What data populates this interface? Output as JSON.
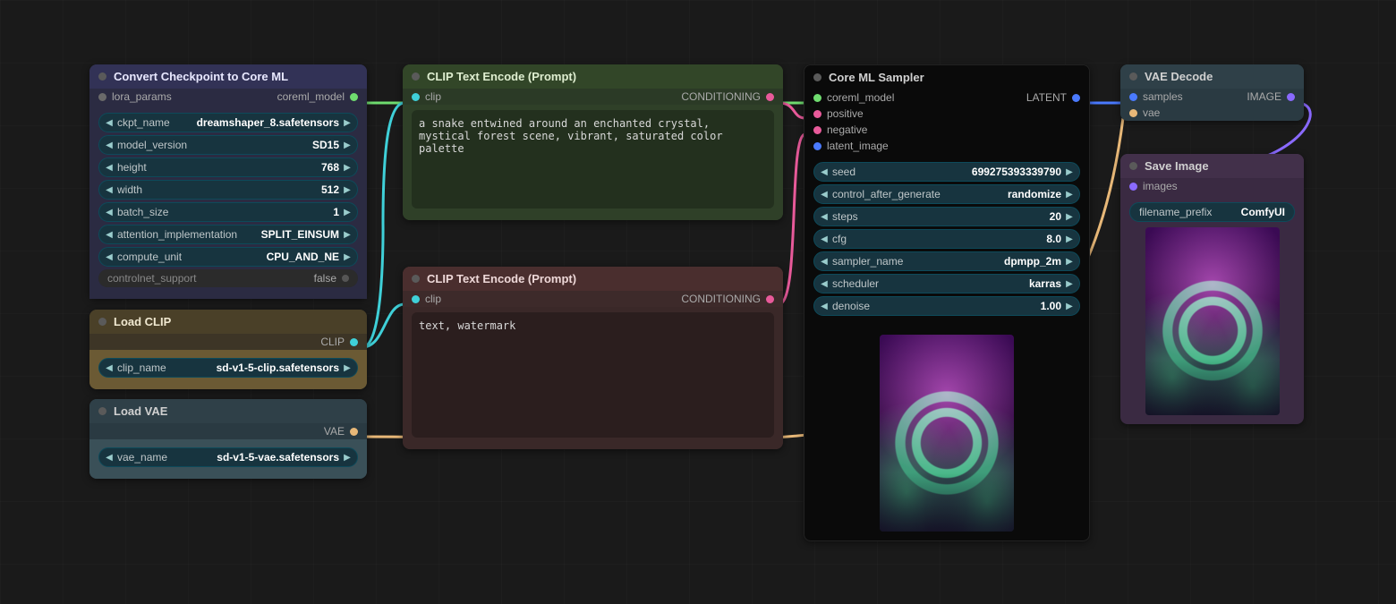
{
  "colors": {
    "port_coreml": "#6fdc6f",
    "port_clip": "#3fd0d8",
    "port_vae": "#e8b878",
    "port_cond": "#e85a9a",
    "port_latent": "#4a7aff",
    "port_image": "#8a6aff",
    "port_grey": "#6a6a6a"
  },
  "convert": {
    "title": "Convert Checkpoint to Core ML",
    "in_lora": "lora_params",
    "out_coreml": "coreml_model",
    "controlnet_label": "controlnet_support",
    "controlnet_value": "false",
    "params": [
      {
        "name": "ckpt_name",
        "value": "dreamshaper_8.safetensors"
      },
      {
        "name": "model_version",
        "value": "SD15"
      },
      {
        "name": "height",
        "value": "768"
      },
      {
        "name": "width",
        "value": "512"
      },
      {
        "name": "batch_size",
        "value": "1"
      },
      {
        "name": "attention_implementation",
        "value": "SPLIT_EINSUM"
      },
      {
        "name": "compute_unit",
        "value": "CPU_AND_NE"
      }
    ]
  },
  "loadclip": {
    "title": "Load CLIP",
    "out": "CLIP",
    "param_name": "clip_name",
    "param_value": "sd-v1-5-clip.safetensors"
  },
  "loadvae": {
    "title": "Load VAE",
    "out": "VAE",
    "param_name": "vae_name",
    "param_value": "sd-v1-5-vae.safetensors"
  },
  "clip_pos": {
    "title": "CLIP Text Encode (Prompt)",
    "in": "clip",
    "out": "CONDITIONING",
    "text": "a snake entwined around an enchanted crystal, mystical forest scene, vibrant, saturated color palette"
  },
  "clip_neg": {
    "title": "CLIP Text Encode (Prompt)",
    "in": "clip",
    "out": "CONDITIONING",
    "text": "text, watermark"
  },
  "sampler": {
    "title": "Core ML Sampler",
    "in_model": "coreml_model",
    "in_pos": "positive",
    "in_neg": "negative",
    "in_latent": "latent_image",
    "out": "LATENT",
    "params": [
      {
        "name": "seed",
        "value": "699275393339790"
      },
      {
        "name": "control_after_generate",
        "value": "randomize"
      },
      {
        "name": "steps",
        "value": "20"
      },
      {
        "name": "cfg",
        "value": "8.0"
      },
      {
        "name": "sampler_name",
        "value": "dpmpp_2m"
      },
      {
        "name": "scheduler",
        "value": "karras"
      },
      {
        "name": "denoise",
        "value": "1.00"
      }
    ]
  },
  "vaedec": {
    "title": "VAE Decode",
    "in_samples": "samples",
    "in_vae": "vae",
    "out": "IMAGE"
  },
  "save": {
    "title": "Save Image",
    "in": "images",
    "param_name": "filename_prefix",
    "param_value": "ComfyUI"
  }
}
